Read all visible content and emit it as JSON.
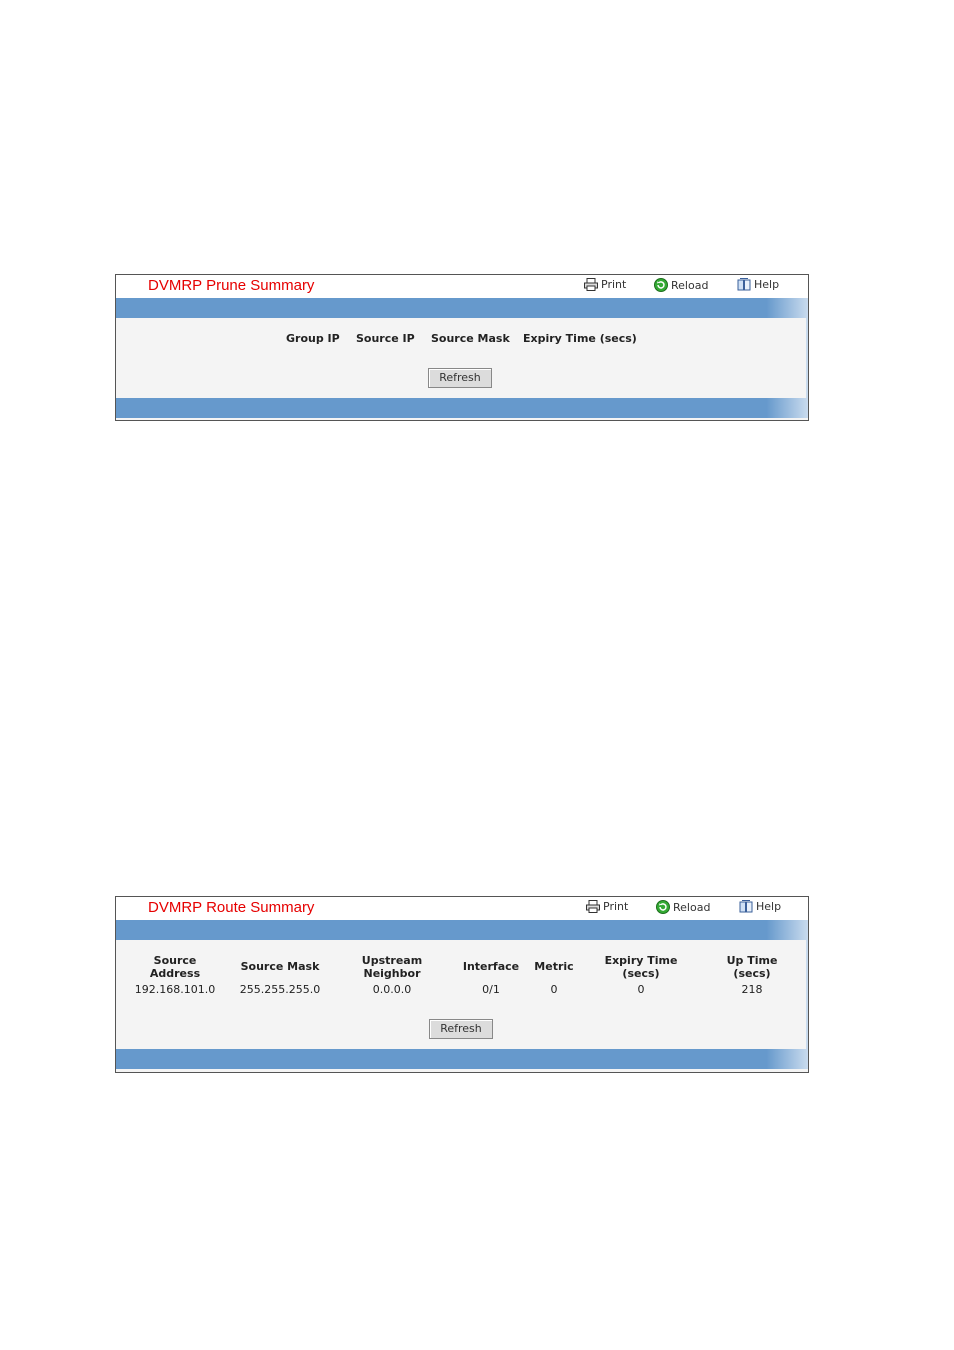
{
  "prune": {
    "title": "DVMRP Prune Summary",
    "toolbar": {
      "print": "Print",
      "reload": "Reload",
      "help": "Help"
    },
    "columns": [
      "Group IP",
      "Source IP",
      "Source Mask",
      "Expiry Time (secs)"
    ],
    "refresh": "Refresh"
  },
  "route": {
    "title": "DVMRP Route Summary",
    "toolbar": {
      "print": "Print",
      "reload": "Reload",
      "help": "Help"
    },
    "columns": [
      {
        "line1": "Source",
        "line2": "Address"
      },
      {
        "line1": "Source Mask",
        "line2": ""
      },
      {
        "line1": "Upstream",
        "line2": "Neighbor"
      },
      {
        "line1": "Interface",
        "line2": ""
      },
      {
        "line1": "Metric",
        "line2": ""
      },
      {
        "line1": "Expiry Time",
        "line2": "(secs)"
      },
      {
        "line1": "Up Time",
        "line2": "(secs)"
      }
    ],
    "rows": [
      [
        "192.168.101.0",
        "255.255.255.0",
        "0.0.0.0",
        "0/1",
        "0",
        "0",
        "218"
      ]
    ],
    "refresh": "Refresh"
  },
  "icons": {
    "print": "printer-icon",
    "reload": "reload-icon",
    "help": "help-book-icon"
  },
  "colors": {
    "title": "#e60000",
    "bar": "#6699cc"
  }
}
